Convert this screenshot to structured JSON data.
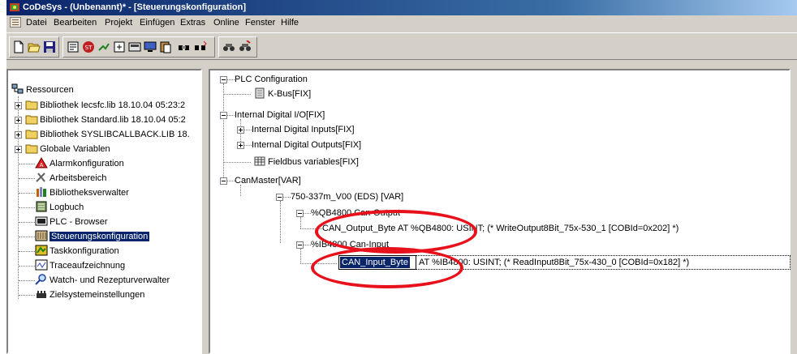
{
  "window": {
    "title": "CoDeSys - (Unbenannt)* - [Steuerungskonfiguration]"
  },
  "menu": [
    "Datei",
    "Bearbeiten",
    "Projekt",
    "Einfügen",
    "Extras",
    "Online",
    "Fenster",
    "Hilfe"
  ],
  "toolbar": {
    "icons": [
      "new-file-icon",
      "open-folder-icon",
      "save-disk-icon",
      "build-icon",
      "stop-icon",
      "login-icon",
      "logout-icon",
      "run-icon",
      "monitor-icon",
      "paste-icon",
      "find-icon",
      "replace-icon"
    ]
  },
  "resources": {
    "root": "Ressourcen",
    "items": [
      "Bibliothek Iecsfc.lib 18.10.04 05:23:2",
      "Bibliothek Standard.lib 18.10.04 05:2",
      "Bibliothek SYSLIBCALLBACK.LIB 18.",
      "Globale Variablen",
      "Alarmkonfiguration",
      "Arbeitsbereich",
      "Bibliotheksverwalter",
      "Logbuch",
      "PLC - Browser",
      "Steuerungskonfiguration",
      "Taskkonfiguration",
      "Traceaufzeichnung",
      "Watch- und Rezepturverwalter",
      "Zielsystemeinstellungen"
    ],
    "selected_index": 9
  },
  "config_tree": {
    "root": "PLC Configuration",
    "kbus": "K-Bus[FIX]",
    "internal_io": "Internal Digital I/O[FIX]",
    "internal_inputs": "Internal Digital Inputs[FIX]",
    "internal_outputs": "Internal Digital Outputs[FIX]",
    "fieldbus": "Fieldbus variables[FIX]",
    "canmaster": "CanMaster[VAR]",
    "module": "750-337m_V00 (EDS)  [VAR]",
    "output_group": "%QB4800 Can-Output",
    "output_var": "CAN_Output_Byte AT %QB4800: USINT; (* WriteOutput8Bit_75x-530_1 [COBId=0x202] *)",
    "input_group": "%IB4800 Can-Input",
    "input_edit": "CAN_Input_Byte",
    "input_rest": "AT %IB4800: USINT; (* ReadInput8Bit_75x-430_0 [COBId=0x182] *)"
  },
  "colors": {
    "highlight": "#e8101a",
    "selection": "#0a246a"
  }
}
